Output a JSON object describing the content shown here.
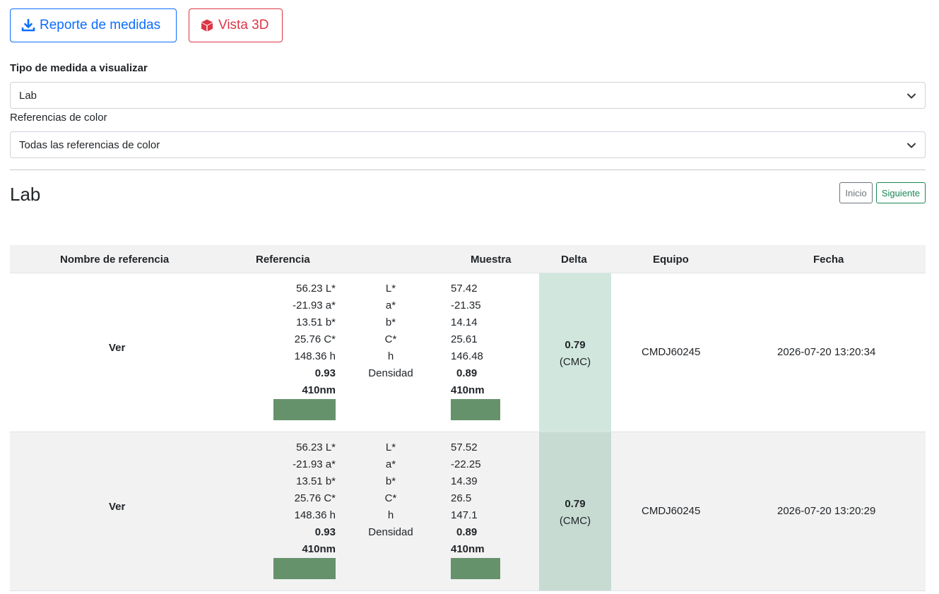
{
  "toolbar": {
    "report_label": "Reporte de medidas",
    "view3d_label": "Vista 3D"
  },
  "filters": {
    "measure_type_label": "Tipo de medida a visualizar",
    "measure_type_value": "Lab",
    "references_label": "Referencias de color",
    "references_value": "Todas las referencias de color"
  },
  "section": {
    "title": "Lab",
    "start_label": "Inicio",
    "next_label": "Siguiente"
  },
  "table": {
    "headers": {
      "name": "Nombre de referencia",
      "reference": "Referencia",
      "sample": "Muestra",
      "delta": "Delta",
      "device": "Equipo",
      "date": "Fecha"
    },
    "rows": [
      {
        "name": "Ver",
        "ref": [
          "56.23 L*",
          "-21.93 a*",
          "13.51 b*",
          "25.76 C*",
          "148.36 h",
          "0.93",
          "410nm"
        ],
        "labels": [
          "L*",
          "a*",
          "b*",
          "C*",
          "h",
          "Densidad"
        ],
        "sample": [
          "57.42",
          "-21.35",
          "14.14",
          "25.61",
          "146.48",
          "0.89",
          "410nm"
        ],
        "delta_value": "0.79",
        "delta_unit": "(CMC)",
        "device": "CMDJ60245",
        "date": "2026-07-20 13:20:34"
      },
      {
        "name": "Ver",
        "ref": [
          "56.23 L*",
          "-21.93 a*",
          "13.51 b*",
          "25.76 C*",
          "148.36 h",
          "0.93",
          "410nm"
        ],
        "labels": [
          "L*",
          "a*",
          "b*",
          "C*",
          "h",
          "Densidad"
        ],
        "sample": [
          "57.52",
          "-22.25",
          "14.39",
          "26.5",
          "147.1",
          "0.89",
          "410nm"
        ],
        "delta_value": "0.79",
        "delta_unit": "(CMC)",
        "device": "CMDJ60245",
        "date": "2026-07-20 13:20:29"
      }
    ]
  },
  "colors": {
    "swatch": "#66926b",
    "delta_bg": "#d1e7dd",
    "primary": "#0d6efd",
    "danger": "#dc3545",
    "success": "#198754"
  }
}
